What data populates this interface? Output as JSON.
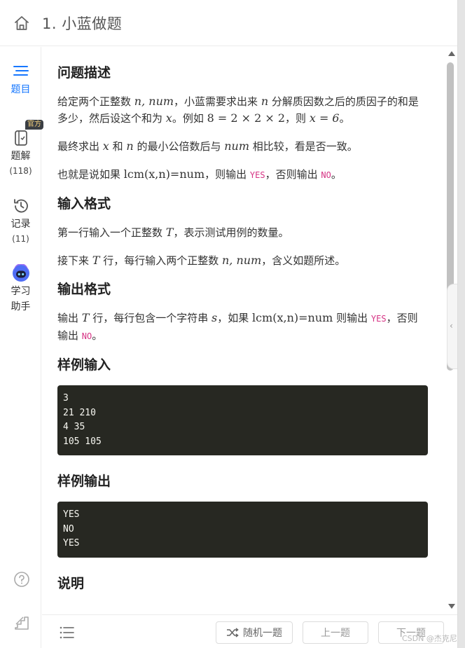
{
  "header": {
    "title": "1. 小蓝做题"
  },
  "sidebar": {
    "items": [
      {
        "label": "题目",
        "count": ""
      },
      {
        "label": "题解",
        "count": "(118)",
        "badge": "官方"
      },
      {
        "label": "记录",
        "count": "(11)"
      },
      {
        "label": "学习",
        "label2": "助手"
      }
    ]
  },
  "problem": {
    "desc_title": "问题描述",
    "desc_p1": {
      "a": "给定两个正整数 ",
      "b": "，小蓝需要求出来 ",
      "c": " 分解质因数之后的质因子的和是多少，然后设这个和为 ",
      "d": "。例如 ",
      "e": "，则 ",
      "f": "。",
      "m_vars": "n, num",
      "m_n": "n",
      "m_x": "x",
      "m_example": "8 = 2 × 2 × 2",
      "m_result": "x = 6"
    },
    "desc_p2": {
      "a": "最终求出 ",
      "b": " 和 ",
      "c": " 的最小公倍数后与 ",
      "d": " 相比较，看是否一致。",
      "m_x": "x",
      "m_n": "n",
      "m_num": "num"
    },
    "desc_p3": {
      "a": "也就是说如果 ",
      "m_cond": "lcm(x,n)=num",
      "b": "，则输出 ",
      "yes": "YES",
      "c": "，否则输出 ",
      "no": "NO",
      "d": "。"
    },
    "input_title": "输入格式",
    "input_p1": {
      "a": "第一行输入一个正整数 ",
      "m_T": "T",
      "b": "，表示测试用例的数量。"
    },
    "input_p2": {
      "a": "接下来 ",
      "m_T": "T",
      "b": " 行，每行输入两个正整数 ",
      "m_vars": "n, num",
      "c": "，含义如题所述。"
    },
    "output_title": "输出格式",
    "output_p1": {
      "a": "输出 ",
      "m_T": "T",
      "b": " 行，每行包含一个字符串 ",
      "m_s": "s",
      "c": "，如果 ",
      "m_cond": "lcm(x,n)=num",
      "d": " 则输出 ",
      "yes": "YES",
      "e": "，否则输出 ",
      "no": "NO",
      "f": "。"
    },
    "sample_in_title": "样例输入",
    "sample_in": "3\n21 210\n4 35\n105 105",
    "sample_out_title": "样例输出",
    "sample_out": "YES\nNO\nYES",
    "explain_title": "说明"
  },
  "footer": {
    "random_label": "随机一题",
    "prev_label": "上一题",
    "next_label": "下一题"
  },
  "watermark": "CSDN @杰克尼",
  "colors": {
    "accent": "#1677ff",
    "code_bg": "#272822",
    "inline_code": "#d63384"
  }
}
